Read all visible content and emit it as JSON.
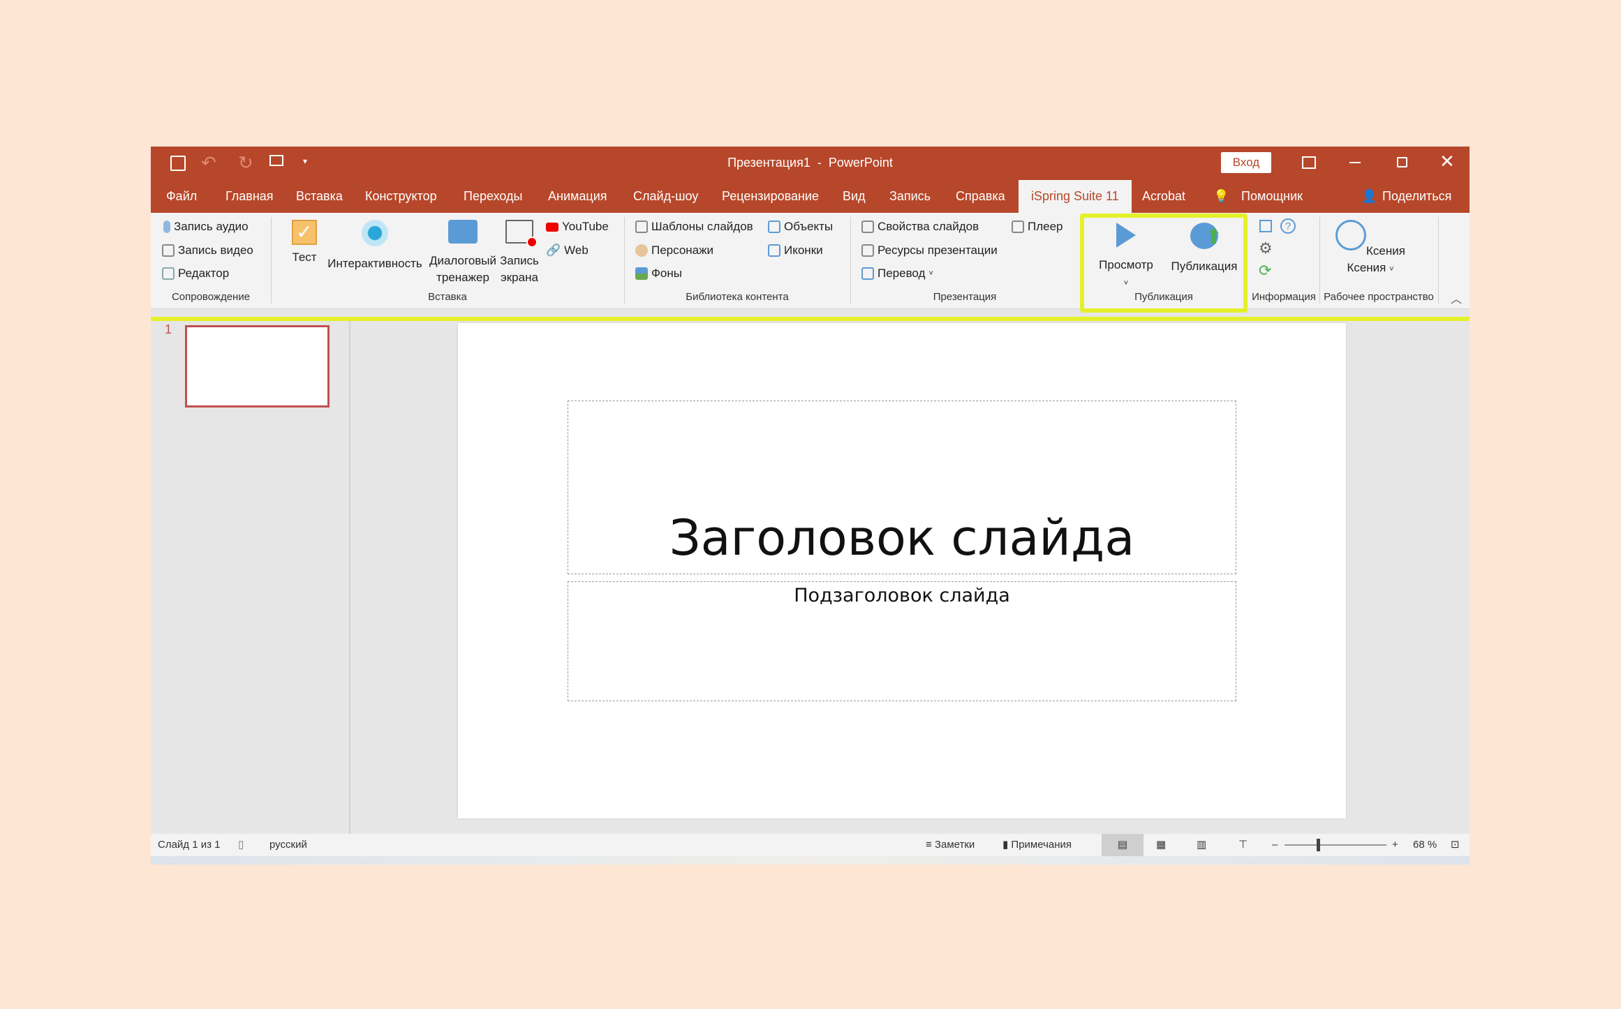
{
  "window": {
    "title": "Презентация1  -  PowerPoint",
    "signin": "Вход"
  },
  "quick_access": [
    "save-icon",
    "undo-icon",
    "redo-icon",
    "start-slideshow-icon",
    "customize-icon"
  ],
  "tabs": [
    "Файл",
    "Главная",
    "Вставка",
    "Конструктор",
    "Переходы",
    "Анимация",
    "Слайд-шоу",
    "Рецензирование",
    "Вид",
    "Запись",
    "Справка",
    "iSpring Suite 11",
    "Acrobat",
    "Помощник",
    "Поделиться"
  ],
  "active_tab": "iSpring Suite 11",
  "ribbon": {
    "narration": {
      "label": "Сопровождение",
      "items": [
        "Запись аудио",
        "Запись видео",
        "Редактор"
      ]
    },
    "insert": {
      "label": "Вставка",
      "test": "Тест",
      "interactivity": "Интерактивность",
      "dialog": [
        "Диалоговый",
        "тренажер"
      ],
      "screen": [
        "Запись",
        "экрана"
      ],
      "youtube": "YouTube",
      "web": "Web"
    },
    "library": {
      "label": "Библиотека контента",
      "items": [
        "Шаблоны слайдов",
        "Персонажи",
        "Фоны",
        "Объекты",
        "Иконки"
      ]
    },
    "presentation": {
      "label": "Презентация",
      "items": [
        "Свойства слайдов",
        "Ресурсы презентации",
        "Перевод",
        "Плеер"
      ]
    },
    "publish": {
      "label": "Публикация",
      "preview": "Просмотр",
      "publish": "Публикация"
    },
    "info": {
      "label": "Информация"
    },
    "workspace": {
      "label": "Рабочее пространство",
      "user": [
        "Ксения",
        "Ксения"
      ]
    }
  },
  "highlight_color": "#e4f02a",
  "accent": "#b7472a",
  "slides": {
    "number": "1"
  },
  "slide": {
    "title": "Заголовок слайда",
    "subtitle": "Подзаголовок слайда"
  },
  "status": {
    "slide": "Слайд 1 из 1",
    "language": "русский",
    "notes": "Заметки",
    "comments": "Примечания",
    "zoom": "68 %",
    "zoom_value": 68
  }
}
